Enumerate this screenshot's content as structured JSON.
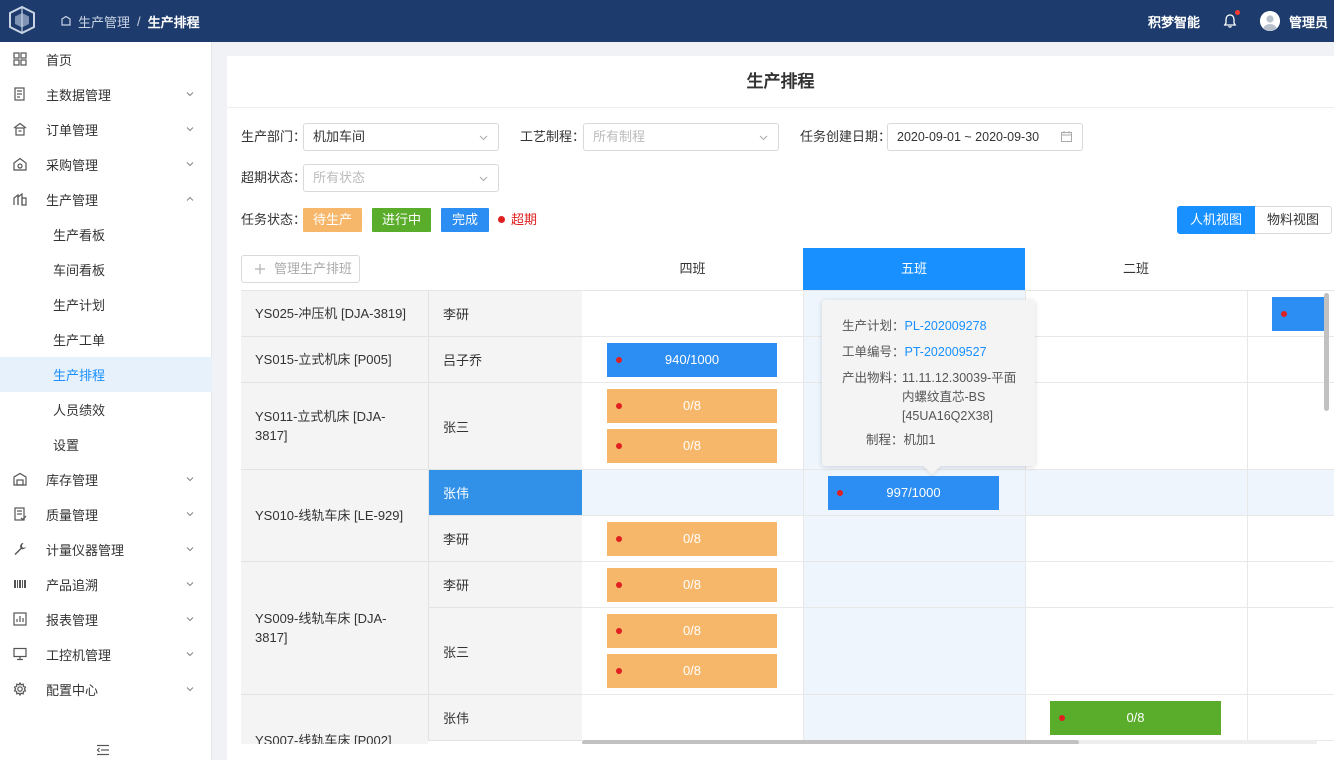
{
  "topbar": {
    "breadcrumb": [
      "生产管理",
      "生产排程"
    ],
    "breadcrumb_sep": "/",
    "brand": "积梦智能",
    "user": "管理员"
  },
  "sidebar": {
    "items": [
      {
        "label": "首页",
        "icon": "grid-icon"
      },
      {
        "label": "主数据管理",
        "icon": "database-icon"
      },
      {
        "label": "订单管理",
        "icon": "order-icon"
      },
      {
        "label": "采购管理",
        "icon": "purchase-icon"
      },
      {
        "label": "生产管理",
        "icon": "production-icon"
      },
      {
        "label": "生产看板"
      },
      {
        "label": "车间看板"
      },
      {
        "label": "生产计划"
      },
      {
        "label": "生产工单"
      },
      {
        "label": "生产排程"
      },
      {
        "label": "人员绩效"
      },
      {
        "label": "设置"
      },
      {
        "label": "库存管理",
        "icon": "warehouse-icon"
      },
      {
        "label": "质量管理",
        "icon": "quality-icon"
      },
      {
        "label": "计量仪器管理",
        "icon": "wrench-icon"
      },
      {
        "label": "产品追溯",
        "icon": "trace-icon"
      },
      {
        "label": "报表管理",
        "icon": "report-icon"
      },
      {
        "label": "工控机管理",
        "icon": "monitor-icon"
      },
      {
        "label": "配置中心",
        "icon": "gear-icon"
      }
    ],
    "active_label": "生产排程"
  },
  "page": {
    "title": "生产排程",
    "filters": {
      "department_label": "生产部门：",
      "department_value": "机加车间",
      "process_label": "工艺制程：",
      "process_placeholder": "所有制程",
      "date_label": "任务创建日期：",
      "date_value": "2020-09-01 ~ 2020-09-30",
      "overdue_label": "超期状态：",
      "overdue_placeholder": "所有状态"
    },
    "status_legend": {
      "label": "任务状态：",
      "pending": "待生产",
      "in_progress": "进行中",
      "done": "完成",
      "overdue": "超期"
    },
    "views": [
      "人机视图",
      "物料视图"
    ],
    "manage_button": "管理生产排班"
  },
  "schedule": {
    "shifts": [
      "四班",
      "五班",
      "二班"
    ],
    "selected_shift": "五班",
    "machines": [
      {
        "name": "YS025-冲压机 [DJA-3819]",
        "workers": [
          "李研"
        ]
      },
      {
        "name": "YS015-立式机床 [P005]",
        "workers": [
          "吕子乔"
        ]
      },
      {
        "name": "YS011-立式机床 [DJA-3817]",
        "workers": [
          "张三"
        ]
      },
      {
        "name": "YS010-线轨车床 [LE-929]",
        "workers": [
          "张伟",
          "李研"
        ]
      },
      {
        "name": "YS009-线轨车床 [DJA-3817]",
        "workers": [
          "李研",
          "张三"
        ]
      },
      {
        "name": "YS007-线轨车床 [P002]",
        "workers": [
          "张伟"
        ]
      }
    ],
    "tasks": [
      {
        "label": "940/1000",
        "status": "done",
        "overdue": true
      },
      {
        "label": "0/8",
        "status": "pending",
        "overdue": true
      },
      {
        "label": "0/8",
        "status": "pending",
        "overdue": true
      },
      {
        "label": "997/1000",
        "status": "done",
        "overdue": true
      },
      {
        "label": "0/8",
        "status": "pending",
        "overdue": true
      },
      {
        "label": "0/8",
        "status": "pending",
        "overdue": true
      },
      {
        "label": "0/8",
        "status": "pending",
        "overdue": true
      },
      {
        "label": "0/8",
        "status": "pending",
        "overdue": true
      },
      {
        "label": "0/8",
        "status": "in_progress",
        "overdue": true
      },
      {
        "label": "",
        "status": "done",
        "overdue": true
      }
    ]
  },
  "tooltip": {
    "plan_label": "生产计划：",
    "plan_value": "PL-202009278",
    "order_label": "工单编号：",
    "order_value": "PT-202009527",
    "material_label": "产出物料：",
    "material_value": "11.11.12.30039-平面内螺纹直芯-BS [45UA16Q2X38]",
    "process_label": "制程：",
    "process_value": "机加1"
  },
  "colors": {
    "topbar": "#1d3b6c",
    "accent": "#1890ff",
    "pending": "#f7b76a",
    "in_progress": "#5aac2b",
    "done": "#2c8ef2",
    "overdue": "#e02020"
  }
}
